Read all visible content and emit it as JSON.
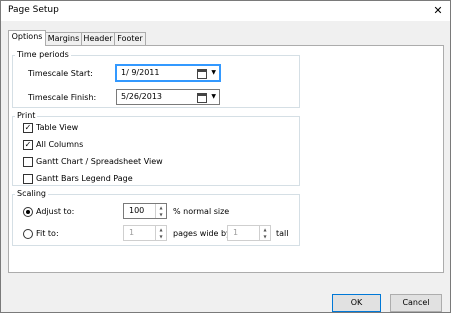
{
  "window": {
    "title": "Page Setup"
  },
  "tabs": [
    {
      "label": "Options"
    },
    {
      "label": "Margins"
    },
    {
      "label": "Header"
    },
    {
      "label": "Footer"
    }
  ],
  "time_periods": {
    "legend": "Time periods",
    "start_label": "Timescale Start:",
    "start_value": "1/ 9/2011",
    "finish_label": "Timescale Finish:",
    "finish_value": "5/26/2013"
  },
  "print": {
    "legend": "Print",
    "options": [
      {
        "label": "Table View",
        "mark": "✓"
      },
      {
        "label": "All Columns",
        "mark": "✓"
      },
      {
        "label": "Gantt Chart / Spreadsheet View",
        "mark": ""
      },
      {
        "label": "Gantt Bars Legend Page",
        "mark": ""
      }
    ]
  },
  "scaling": {
    "legend": "Scaling",
    "adjust_label": "Adjust to:",
    "adjust_value": "100",
    "adjust_suffix": "% normal size",
    "fit_label": "Fit to:",
    "fit_wide_value": "1",
    "pages_wide_label": "pages wide by",
    "fit_tall_value": "1",
    "tall_label": "tall"
  },
  "buttons": {
    "ok": "OK",
    "cancel": "Cancel"
  },
  "icons": {
    "close": "close-icon",
    "calendar": "calendar-icon"
  }
}
